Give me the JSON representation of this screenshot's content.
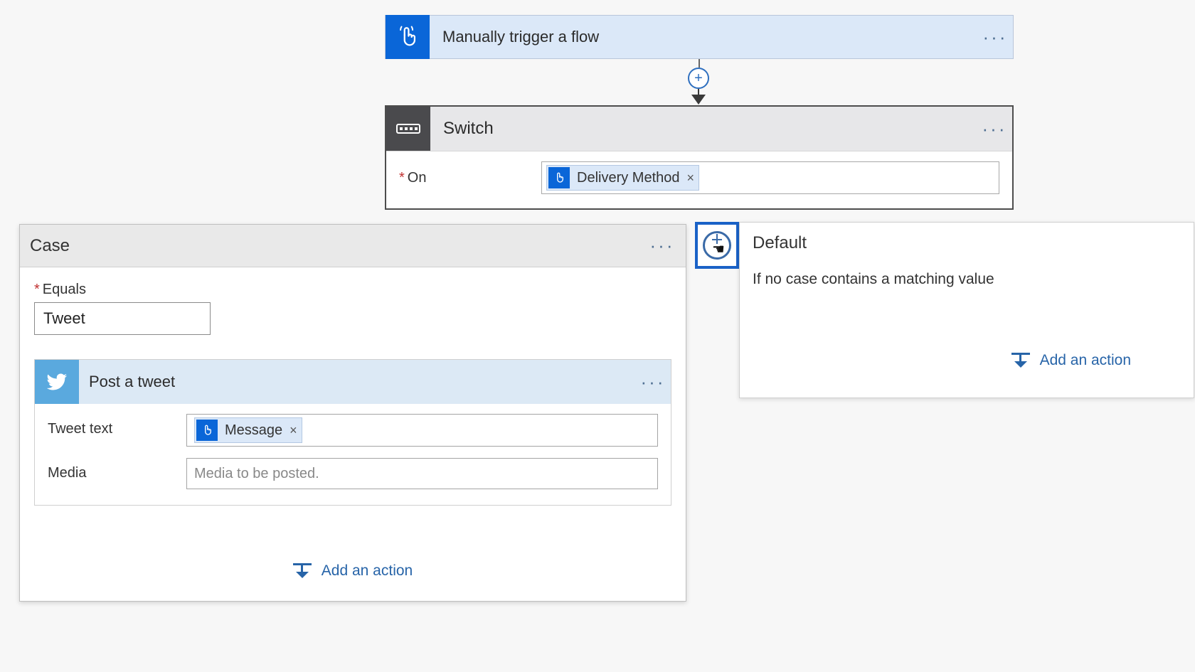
{
  "trigger": {
    "title": "Manually trigger a flow"
  },
  "switch": {
    "title": "Switch",
    "on_label": "On",
    "on_token": "Delivery Method"
  },
  "case": {
    "title": "Case",
    "equals_label": "Equals",
    "equals_value": "Tweet",
    "tweet": {
      "title": "Post a tweet",
      "text_label": "Tweet text",
      "text_token": "Message",
      "media_label": "Media",
      "media_placeholder": "Media to be posted."
    },
    "add_action_label": "Add an action"
  },
  "default": {
    "title": "Default",
    "description": "If no case contains a matching value",
    "add_action_label": "Add an action"
  }
}
